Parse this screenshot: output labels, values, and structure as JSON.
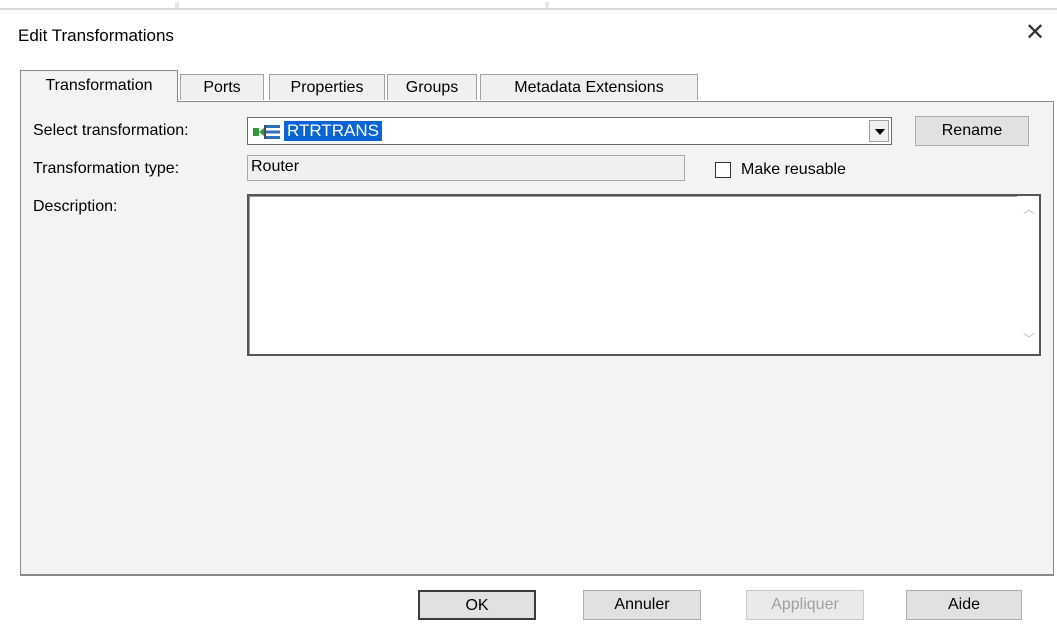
{
  "dialog": {
    "title": "Edit Transformations",
    "close_glyph": "✕"
  },
  "tabs": [
    {
      "label": "Transformation",
      "active": true
    },
    {
      "label": "Ports",
      "active": false
    },
    {
      "label": "Properties",
      "active": false
    },
    {
      "label": "Groups",
      "active": false
    },
    {
      "label": "Metadata Extensions",
      "active": false
    }
  ],
  "form": {
    "select_label": "Select transformation:",
    "select_value": "RTRTRANS",
    "select_icon": "router-transformation-icon",
    "rename_label": "Rename",
    "type_label": "Transformation type:",
    "type_value": "Router",
    "reusable_label": "Make reusable",
    "reusable_checked": false,
    "description_label": "Description:",
    "description_value": ""
  },
  "buttons": {
    "ok": "OK",
    "cancel": "Annuler",
    "apply": "Appliquer",
    "help": "Aide"
  },
  "colors": {
    "selection": "#0a64d6",
    "panel": "#f3f3f3"
  }
}
